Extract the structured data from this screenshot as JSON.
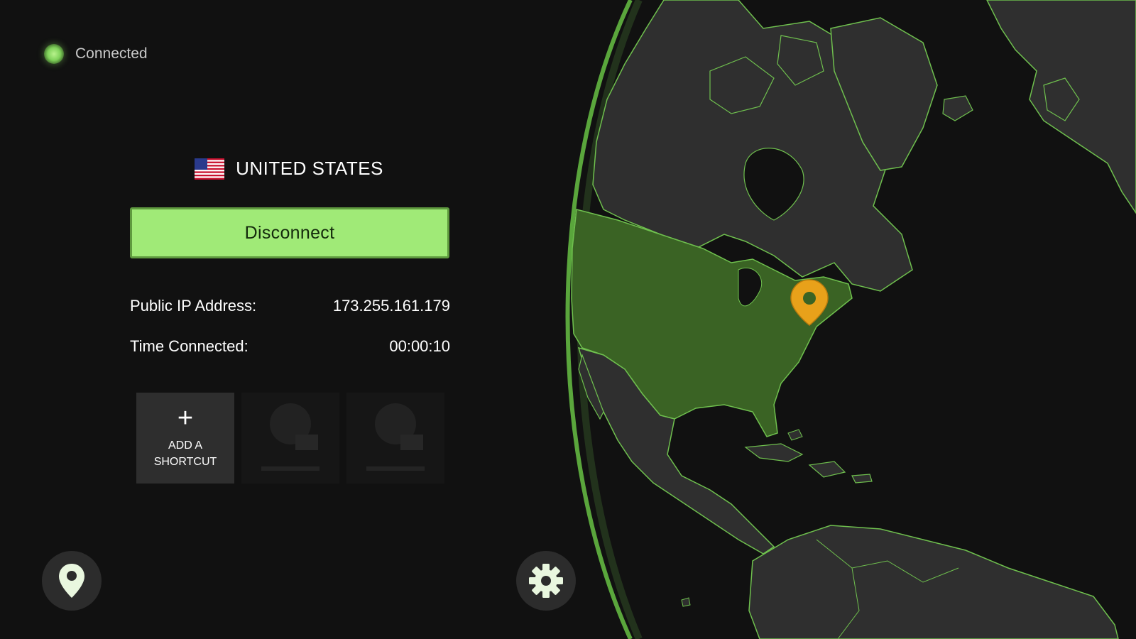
{
  "status": {
    "text": "Connected",
    "color": "#8fd96a"
  },
  "country": {
    "name": "UNITED STATES",
    "flag_icon": "us-flag-icon"
  },
  "disconnect_button": {
    "label": "Disconnect",
    "background": "#a0ea77"
  },
  "info": {
    "ip_label": "Public IP Address:",
    "ip_value": "173.255.161.179",
    "time_label": "Time Connected:",
    "time_value": "00:00:10"
  },
  "shortcuts": {
    "add_label": "ADD A SHORTCUT",
    "add_icon": "plus-icon",
    "placeholder_count": 2
  },
  "bottom_buttons": {
    "location_icon": "location-pin-icon",
    "settings_icon": "gear-icon"
  },
  "map": {
    "highlighted_country": "United States",
    "highlight_color": "#3a6324",
    "border_color": "#6fc04e",
    "marker_color": "#e8a11a"
  }
}
